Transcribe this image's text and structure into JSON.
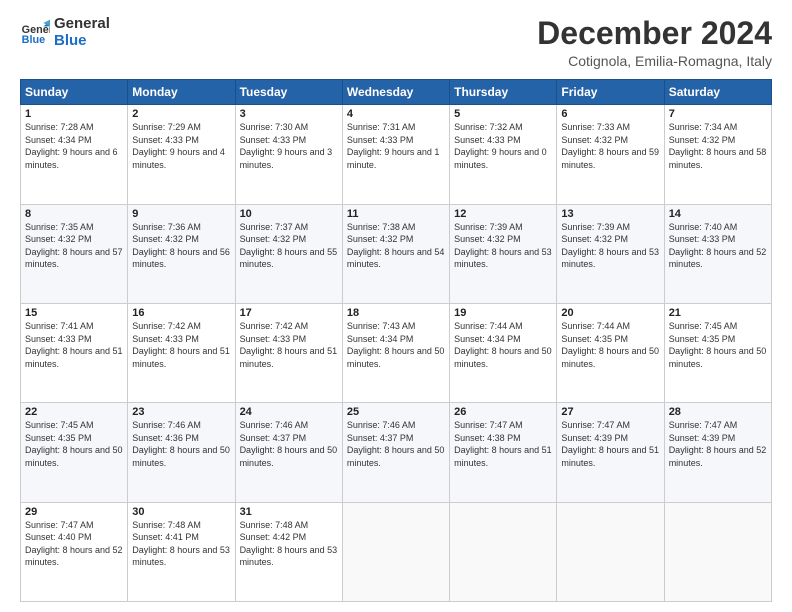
{
  "header": {
    "logo_line1": "General",
    "logo_line2": "Blue",
    "month": "December 2024",
    "location": "Cotignola, Emilia-Romagna, Italy"
  },
  "weekdays": [
    "Sunday",
    "Monday",
    "Tuesday",
    "Wednesday",
    "Thursday",
    "Friday",
    "Saturday"
  ],
  "weeks": [
    [
      {
        "day": "1",
        "rise": "Sunrise: 7:28 AM",
        "set": "Sunset: 4:34 PM",
        "daylight": "Daylight: 9 hours and 6 minutes."
      },
      {
        "day": "2",
        "rise": "Sunrise: 7:29 AM",
        "set": "Sunset: 4:33 PM",
        "daylight": "Daylight: 9 hours and 4 minutes."
      },
      {
        "day": "3",
        "rise": "Sunrise: 7:30 AM",
        "set": "Sunset: 4:33 PM",
        "daylight": "Daylight: 9 hours and 3 minutes."
      },
      {
        "day": "4",
        "rise": "Sunrise: 7:31 AM",
        "set": "Sunset: 4:33 PM",
        "daylight": "Daylight: 9 hours and 1 minute."
      },
      {
        "day": "5",
        "rise": "Sunrise: 7:32 AM",
        "set": "Sunset: 4:33 PM",
        "daylight": "Daylight: 9 hours and 0 minutes."
      },
      {
        "day": "6",
        "rise": "Sunrise: 7:33 AM",
        "set": "Sunset: 4:32 PM",
        "daylight": "Daylight: 8 hours and 59 minutes."
      },
      {
        "day": "7",
        "rise": "Sunrise: 7:34 AM",
        "set": "Sunset: 4:32 PM",
        "daylight": "Daylight: 8 hours and 58 minutes."
      }
    ],
    [
      {
        "day": "8",
        "rise": "Sunrise: 7:35 AM",
        "set": "Sunset: 4:32 PM",
        "daylight": "Daylight: 8 hours and 57 minutes."
      },
      {
        "day": "9",
        "rise": "Sunrise: 7:36 AM",
        "set": "Sunset: 4:32 PM",
        "daylight": "Daylight: 8 hours and 56 minutes."
      },
      {
        "day": "10",
        "rise": "Sunrise: 7:37 AM",
        "set": "Sunset: 4:32 PM",
        "daylight": "Daylight: 8 hours and 55 minutes."
      },
      {
        "day": "11",
        "rise": "Sunrise: 7:38 AM",
        "set": "Sunset: 4:32 PM",
        "daylight": "Daylight: 8 hours and 54 minutes."
      },
      {
        "day": "12",
        "rise": "Sunrise: 7:39 AM",
        "set": "Sunset: 4:32 PM",
        "daylight": "Daylight: 8 hours and 53 minutes."
      },
      {
        "day": "13",
        "rise": "Sunrise: 7:39 AM",
        "set": "Sunset: 4:32 PM",
        "daylight": "Daylight: 8 hours and 53 minutes."
      },
      {
        "day": "14",
        "rise": "Sunrise: 7:40 AM",
        "set": "Sunset: 4:33 PM",
        "daylight": "Daylight: 8 hours and 52 minutes."
      }
    ],
    [
      {
        "day": "15",
        "rise": "Sunrise: 7:41 AM",
        "set": "Sunset: 4:33 PM",
        "daylight": "Daylight: 8 hours and 51 minutes."
      },
      {
        "day": "16",
        "rise": "Sunrise: 7:42 AM",
        "set": "Sunset: 4:33 PM",
        "daylight": "Daylight: 8 hours and 51 minutes."
      },
      {
        "day": "17",
        "rise": "Sunrise: 7:42 AM",
        "set": "Sunset: 4:33 PM",
        "daylight": "Daylight: 8 hours and 51 minutes."
      },
      {
        "day": "18",
        "rise": "Sunrise: 7:43 AM",
        "set": "Sunset: 4:34 PM",
        "daylight": "Daylight: 8 hours and 50 minutes."
      },
      {
        "day": "19",
        "rise": "Sunrise: 7:44 AM",
        "set": "Sunset: 4:34 PM",
        "daylight": "Daylight: 8 hours and 50 minutes."
      },
      {
        "day": "20",
        "rise": "Sunrise: 7:44 AM",
        "set": "Sunset: 4:35 PM",
        "daylight": "Daylight: 8 hours and 50 minutes."
      },
      {
        "day": "21",
        "rise": "Sunrise: 7:45 AM",
        "set": "Sunset: 4:35 PM",
        "daylight": "Daylight: 8 hours and 50 minutes."
      }
    ],
    [
      {
        "day": "22",
        "rise": "Sunrise: 7:45 AM",
        "set": "Sunset: 4:35 PM",
        "daylight": "Daylight: 8 hours and 50 minutes."
      },
      {
        "day": "23",
        "rise": "Sunrise: 7:46 AM",
        "set": "Sunset: 4:36 PM",
        "daylight": "Daylight: 8 hours and 50 minutes."
      },
      {
        "day": "24",
        "rise": "Sunrise: 7:46 AM",
        "set": "Sunset: 4:37 PM",
        "daylight": "Daylight: 8 hours and 50 minutes."
      },
      {
        "day": "25",
        "rise": "Sunrise: 7:46 AM",
        "set": "Sunset: 4:37 PM",
        "daylight": "Daylight: 8 hours and 50 minutes."
      },
      {
        "day": "26",
        "rise": "Sunrise: 7:47 AM",
        "set": "Sunset: 4:38 PM",
        "daylight": "Daylight: 8 hours and 51 minutes."
      },
      {
        "day": "27",
        "rise": "Sunrise: 7:47 AM",
        "set": "Sunset: 4:39 PM",
        "daylight": "Daylight: 8 hours and 51 minutes."
      },
      {
        "day": "28",
        "rise": "Sunrise: 7:47 AM",
        "set": "Sunset: 4:39 PM",
        "daylight": "Daylight: 8 hours and 52 minutes."
      }
    ],
    [
      {
        "day": "29",
        "rise": "Sunrise: 7:47 AM",
        "set": "Sunset: 4:40 PM",
        "daylight": "Daylight: 8 hours and 52 minutes."
      },
      {
        "day": "30",
        "rise": "Sunrise: 7:48 AM",
        "set": "Sunset: 4:41 PM",
        "daylight": "Daylight: 8 hours and 53 minutes."
      },
      {
        "day": "31",
        "rise": "Sunrise: 7:48 AM",
        "set": "Sunset: 4:42 PM",
        "daylight": "Daylight: 8 hours and 53 minutes."
      },
      null,
      null,
      null,
      null
    ]
  ]
}
